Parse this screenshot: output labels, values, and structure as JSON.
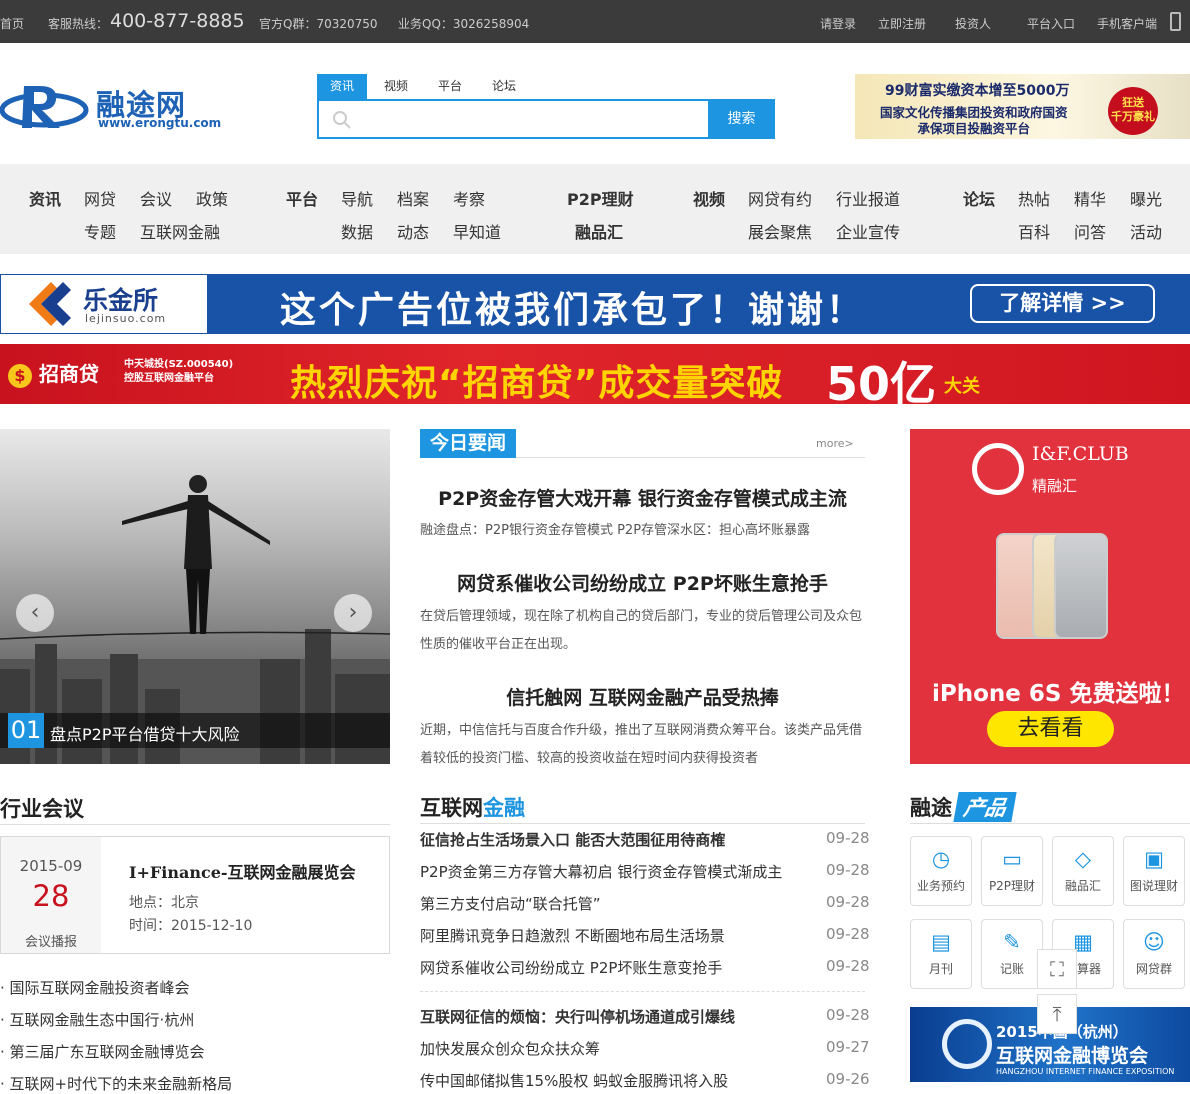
{
  "topbar": {
    "home": "首页",
    "hotline_label": "客服热线：",
    "hotline": "400-877-8885",
    "qq_group": "官方Q群：70320750",
    "biz_qq": "业务QQ：3026258904",
    "login": "请登录",
    "register": "立即注册",
    "investor": "投资人",
    "platform_entry": "平台入口",
    "mobile": "手机客户端"
  },
  "logo": {
    "name": "融途网",
    "url": "www.erongtu.com"
  },
  "search": {
    "tabs": [
      "资讯",
      "视频",
      "平台",
      "论坛"
    ],
    "placeholder": "",
    "button": "搜索"
  },
  "top_ad": {
    "line1": "99财富实缴资本增至5000万",
    "line2a": "国家文化传播集团投资和政府国资",
    "line2b": "承保项目投融资平台",
    "badge1": "狂送",
    "badge2": "千万豪礼"
  },
  "nav": {
    "news": {
      "title": "资讯",
      "items": [
        "网贷",
        "会议",
        "政策",
        "专题",
        "互联网金融"
      ]
    },
    "platform": {
      "title": "平台",
      "items": [
        "导航",
        "档案",
        "考察",
        "数据",
        "动态",
        "早知道"
      ]
    },
    "p2p": {
      "title": "P2P理财",
      "items": [
        "融品汇"
      ]
    },
    "video": {
      "title": "视频",
      "items": [
        "网贷有约",
        "行业报道",
        "展会聚焦",
        "企业宣传"
      ]
    },
    "forum": {
      "title": "论坛",
      "items": [
        "热帖",
        "精华",
        "曝光",
        "百科",
        "问答",
        "活动"
      ]
    }
  },
  "banner1": {
    "name": "乐金所",
    "url": "lejinsuo.com",
    "slogan": "这个广告位被我们承包了！谢谢！",
    "cta": "了解详情 >>"
  },
  "banner2": {
    "brand": "招商贷",
    "sub1": "中天城投(SZ.000540)",
    "sub2": "控股互联网金融平台",
    "main": "热烈庆祝“招商贷”成交量突破",
    "big": "50亿",
    "tail": "大关"
  },
  "slider": {
    "num": "01",
    "caption": "盘点P2P平台借贷十大风险"
  },
  "today": {
    "title": "今日要闻",
    "more": "more>",
    "items": [
      {
        "headline": "P2P资金存管大戏开幕 银行资金存管模式成主流",
        "desc": "融途盘点：P2P银行资金存管模式   P2P存管深水区：担心高坏账暴露"
      },
      {
        "headline": "网贷系催收公司纷纷成立 P2P坏账生意抢手",
        "desc": "在贷后管理领域，现在除了机构自己的贷后部门，专业的贷后管理公司及众包性质的催收平台正在出现。"
      },
      {
        "headline": "信托触网 互联网金融产品受热捧",
        "desc": "近期，中信信托与百度合作升级，推出了互联网消费众筹平台。该类产品凭借着较低的投资门槛、较高的投资收益在短时间内获得投资者"
      }
    ]
  },
  "right_ad": {
    "club": "I&F.CLUB",
    "club_sub": "精融汇",
    "slogan": "iPhone 6S 免费送啦！",
    "cta": "去看看"
  },
  "meeting": {
    "title": "行业会议",
    "card": {
      "month": "2015-09",
      "day": "28",
      "tag": "会议播报",
      "name": "I+Finance-互联网金融展览会",
      "place": "地点：北京",
      "time": "时间：2015-12-10"
    },
    "list": [
      "国际互联网金融投资者峰会",
      "互联网金融生态中国行·杭州",
      "第三届广东互联网金融博览会",
      "互联网+时代下的未来金融新格局"
    ]
  },
  "finance": {
    "title_a": "互联网",
    "title_b": "金融",
    "group1": [
      {
        "t": "征信抢占生活场景入口 能否大范围征用待商榷",
        "d": "09-28",
        "bold": true
      },
      {
        "t": "P2P资金第三方存管大幕初启 银行资金存管模式渐成主",
        "d": "09-28"
      },
      {
        "t": "第三方支付启动“联合托管”",
        "d": "09-28"
      },
      {
        "t": "阿里腾讯竞争日趋激烈 不断圈地布局生活场景",
        "d": "09-28"
      },
      {
        "t": "网贷系催收公司纷纷成立 P2P坏账生意变抢手",
        "d": "09-28"
      }
    ],
    "group2": [
      {
        "t": "互联网征信的烦恼：央行叫停机场通道成引爆线",
        "d": "09-28",
        "bold": true
      },
      {
        "t": "加快发展众创众包众扶众筹",
        "d": "09-27"
      },
      {
        "t": "传中国邮储拟售15%股权 蚂蚁金服腾讯将入股",
        "d": "09-26"
      }
    ]
  },
  "products": {
    "title_a": "融途",
    "title_b": "产品",
    "items": [
      {
        "label": "业务预约",
        "icon": "clock-icon",
        "glyph": "◷"
      },
      {
        "label": "P2P理财",
        "icon": "wallet-icon",
        "glyph": "▭"
      },
      {
        "label": "融品汇",
        "icon": "diamond-icon",
        "glyph": "◇"
      },
      {
        "label": "图说理财",
        "icon": "image-icon",
        "glyph": "▣"
      },
      {
        "label": "月刊",
        "icon": "book-icon",
        "glyph": "▤"
      },
      {
        "label": "记账",
        "icon": "pen-icon",
        "glyph": "✎"
      },
      {
        "label": "计算器",
        "icon": "calculator-icon",
        "glyph": "▦"
      },
      {
        "label": "网贷群",
        "icon": "qq-icon",
        "glyph": "☺"
      }
    ]
  },
  "expo": {
    "line1": "2015中国（杭州）",
    "line2": "互联网金融博览会",
    "line3": "HANGZHOU INTERNET FINANCE EXPOSITION"
  },
  "colors": {
    "accent": "#1d95e0",
    "topbar": "#3b3b3b",
    "red": "#e1323d"
  }
}
